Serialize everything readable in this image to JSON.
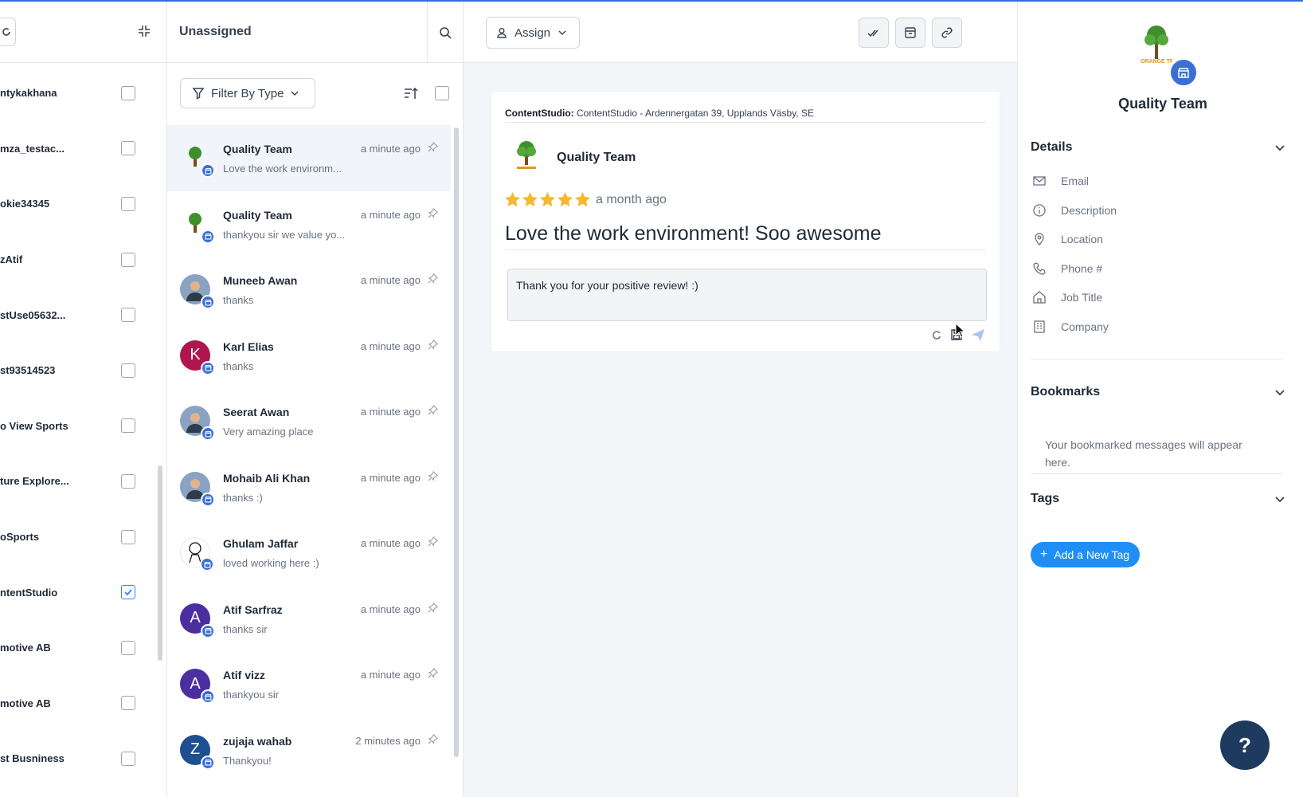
{
  "accounts": [
    {
      "name": "ntykakhana",
      "checked": false
    },
    {
      "name": "mza_testac...",
      "checked": false
    },
    {
      "name": "okie34345",
      "checked": false
    },
    {
      "name": "zAtif",
      "checked": false
    },
    {
      "name": "stUse05632...",
      "checked": false
    },
    {
      "name": "st93514523",
      "checked": false
    },
    {
      "name": "o View Sports",
      "checked": false
    },
    {
      "name": "ture Explore...",
      "checked": false
    },
    {
      "name": "oSports",
      "checked": false
    },
    {
      "name": "ntentStudio",
      "checked": true
    },
    {
      "name": "motive AB",
      "checked": false
    },
    {
      "name": "motive AB",
      "checked": false
    },
    {
      "name": "st Busniness",
      "checked": false
    }
  ],
  "conversations_panel": {
    "title": "Unassigned",
    "filter_label": "Filter By Type"
  },
  "conversations": [
    {
      "name": "Quality Team",
      "time": "a minute ago",
      "preview": "Love the work environm...",
      "avatar": "tree",
      "active": true
    },
    {
      "name": "Quality Team",
      "time": "a minute ago",
      "preview": "thankyou sir we value yo...",
      "avatar": "tree"
    },
    {
      "name": "Muneeb Awan",
      "time": "a minute ago",
      "preview": "thanks",
      "avatar": "photo"
    },
    {
      "name": "Karl Elias",
      "time": "a minute ago",
      "preview": "thanks",
      "avatar": "letter",
      "letter": "K",
      "color": "#b0164e"
    },
    {
      "name": "Seerat Awan",
      "time": "a minute ago",
      "preview": "Very amazing place",
      "avatar": "photo"
    },
    {
      "name": "Mohaib Ali Khan",
      "time": "a minute ago",
      "preview": "thanks :)",
      "avatar": "photo"
    },
    {
      "name": "Ghulam Jaffar",
      "time": "a minute ago",
      "preview": "loved working here :)",
      "avatar": "sketch"
    },
    {
      "name": "Atif Sarfraz",
      "time": "a minute ago",
      "preview": "thanks sir",
      "avatar": "letter",
      "letter": "A",
      "color": "#4b2ea0"
    },
    {
      "name": "Atif vizz",
      "time": "a minute ago",
      "preview": "thankyou sir",
      "avatar": "letter",
      "letter": "A",
      "color": "#4b2ea0"
    },
    {
      "name": "zujaja wahab",
      "time": "2 minutes ago",
      "preview": "Thankyou!",
      "avatar": "letter",
      "letter": "Z",
      "color": "#1d4f91"
    }
  ],
  "thread": {
    "assign_label": "Assign",
    "source_label": "ContentStudio:",
    "source_detail": "ContentStudio - Ardennergatan 39, Upplands Väsby, SE",
    "reviewer": "Quality Team",
    "rating": 5,
    "time": "a month ago",
    "review": "Love the work environment! Soo awesome",
    "reply_text": "Thank you for your positive review! :)"
  },
  "details_panel": {
    "profile_name": "Quality Team",
    "logo_text": "ORANGE TREE",
    "details_title": "Details",
    "fields": [
      "Email",
      "Description",
      "Location",
      "Phone #",
      "Job Title",
      "Company"
    ],
    "bookmarks_title": "Bookmarks",
    "bookmarks_empty": "Your bookmarked messages will appear here.",
    "tags_title": "Tags",
    "add_tag_label": "Add a New Tag"
  },
  "help_label": "?",
  "colors": {
    "accent": "#1f8ff5",
    "badge": "#3b6fd8",
    "help": "#1e3a5f",
    "star": "#f5b82e"
  }
}
